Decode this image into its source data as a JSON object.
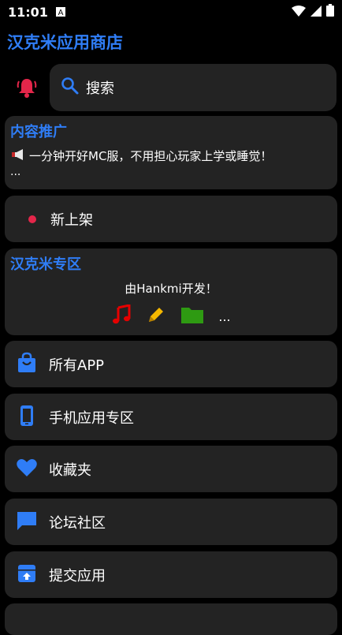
{
  "status": {
    "time": "11:01"
  },
  "app": {
    "title": "汉克米应用商店"
  },
  "search": {
    "label": "搜索"
  },
  "promo": {
    "title": "内容推广",
    "text": "一分钟开好MC服，不用担心玩家上学或睡觉！",
    "more": "..."
  },
  "newshelf": {
    "label": "新上架"
  },
  "zone": {
    "title": "汉克米专区",
    "subtitle": "由Hankmi开发！",
    "more": "..."
  },
  "menu": [
    {
      "label": "所有APP",
      "icon": "shopping-bag-icon"
    },
    {
      "label": "手机应用专区",
      "icon": "phone-icon"
    },
    {
      "label": "收藏夹",
      "icon": "heart-icon"
    },
    {
      "label": "论坛社区",
      "icon": "chat-icon"
    },
    {
      "label": "提交应用",
      "icon": "upload-box-icon"
    }
  ],
  "colors": {
    "accent": "#2f7df6",
    "bell": "#e4264a",
    "card": "#232323"
  }
}
